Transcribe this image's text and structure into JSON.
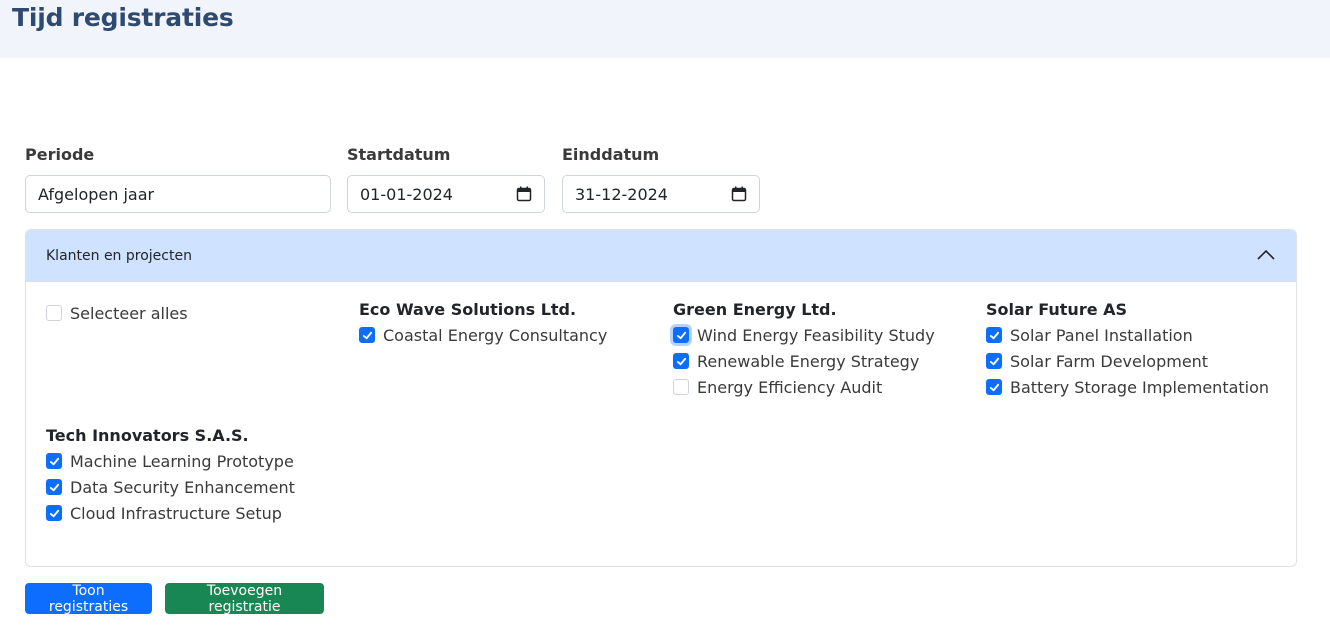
{
  "page": {
    "title": "Tijd registraties"
  },
  "filters": {
    "period_label": "Periode",
    "period_value": "Afgelopen jaar",
    "start_label": "Startdatum",
    "start_value": "01-01-2024",
    "end_label": "Einddatum",
    "end_value": "31-12-2024"
  },
  "accordion": {
    "title": "Klanten en projecten",
    "select_all": {
      "label": "Selecteer alles",
      "checked": false
    },
    "groups": [
      {
        "client": "Eco Wave Solutions Ltd.",
        "projects": [
          {
            "label": "Coastal Energy Consultancy",
            "checked": true
          }
        ]
      },
      {
        "client": "Green Energy Ltd.",
        "projects": [
          {
            "label": "Wind Energy Feasibility Study",
            "checked": true
          },
          {
            "label": "Renewable Energy Strategy",
            "checked": true
          },
          {
            "label": "Energy Efficiency Audit",
            "checked": false
          }
        ]
      },
      {
        "client": "Solar Future AS",
        "projects": [
          {
            "label": "Solar Panel Installation",
            "checked": true
          },
          {
            "label": "Solar Farm Development",
            "checked": true
          },
          {
            "label": "Battery Storage Implementation",
            "checked": true
          }
        ]
      },
      {
        "client": "Tech Innovators S.A.S.",
        "projects": [
          {
            "label": "Machine Learning Prototype",
            "checked": true
          },
          {
            "label": "Data Security Enhancement",
            "checked": true
          },
          {
            "label": "Cloud Infrastructure Setup",
            "checked": true
          }
        ]
      }
    ]
  },
  "actions": {
    "show_label": "Toon registraties",
    "add_label": "Toevoegen registratie"
  },
  "colors": {
    "primary": "#0d6efd",
    "success": "#198754",
    "accordion_header": "#cfe2ff",
    "title": "#2e4a6f"
  },
  "icons": {
    "date": "calendar-icon",
    "collapse": "chevron-up-icon",
    "check": "check-icon"
  }
}
